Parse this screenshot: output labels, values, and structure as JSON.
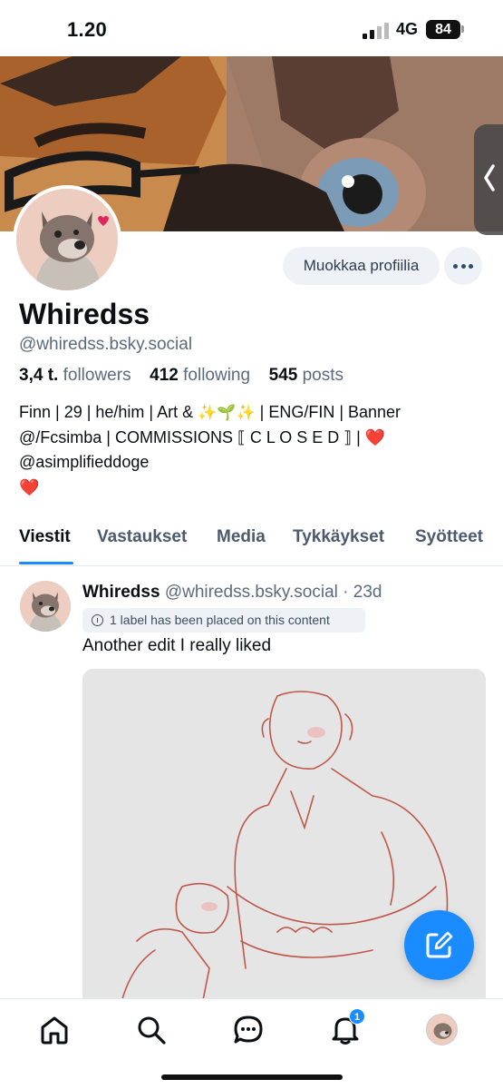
{
  "status_bar": {
    "time": "1.20",
    "network": "4G",
    "battery": "84"
  },
  "profile": {
    "display_name": "Whiredss",
    "handle": "@whiredss.bsky.social",
    "edit_button_label": "Muokkaa profiilia",
    "stats": {
      "followers_count": "3,4 t.",
      "followers_label": "followers",
      "following_count": "412",
      "following_label": "following",
      "posts_count": "545",
      "posts_label": "posts"
    },
    "bio": {
      "line1_a": "Finn | 29 | he/him | Art & ",
      "line1_emoji": "✨🌱✨",
      "line1_b": " | ENG/FIN | Banner",
      "line2": "@/Fcsimba | COMMISSIONS ⟦ C L O S E D ⟧ | ",
      "line2_heart": "❤️",
      "line3": "@asimplifieddoge",
      "line4_heart": "❤️"
    }
  },
  "tabs": [
    {
      "label": "Viestit",
      "active": true
    },
    {
      "label": "Vastaukset",
      "active": false
    },
    {
      "label": "Media",
      "active": false
    },
    {
      "label": "Tykkäykset",
      "active": false
    },
    {
      "label": "Syötteet",
      "active": false
    }
  ],
  "post": {
    "author_name": "Whiredss",
    "author_meta": "@whiredss.bsky.social · 23d",
    "label_notice": "1 label has been placed on this content",
    "text": "Another edit I really liked"
  },
  "bottom_nav": {
    "notifications_badge": "1"
  },
  "colors": {
    "accent": "#1a8cff",
    "muted_text": "#5b6b7d",
    "button_bg": "#eef2f6",
    "heart": "#e0245e"
  },
  "icons": [
    "home-icon",
    "search-icon",
    "chat-icon",
    "bell-icon",
    "compose-icon",
    "more-icon",
    "info-icon",
    "chevron-left-icon"
  ]
}
